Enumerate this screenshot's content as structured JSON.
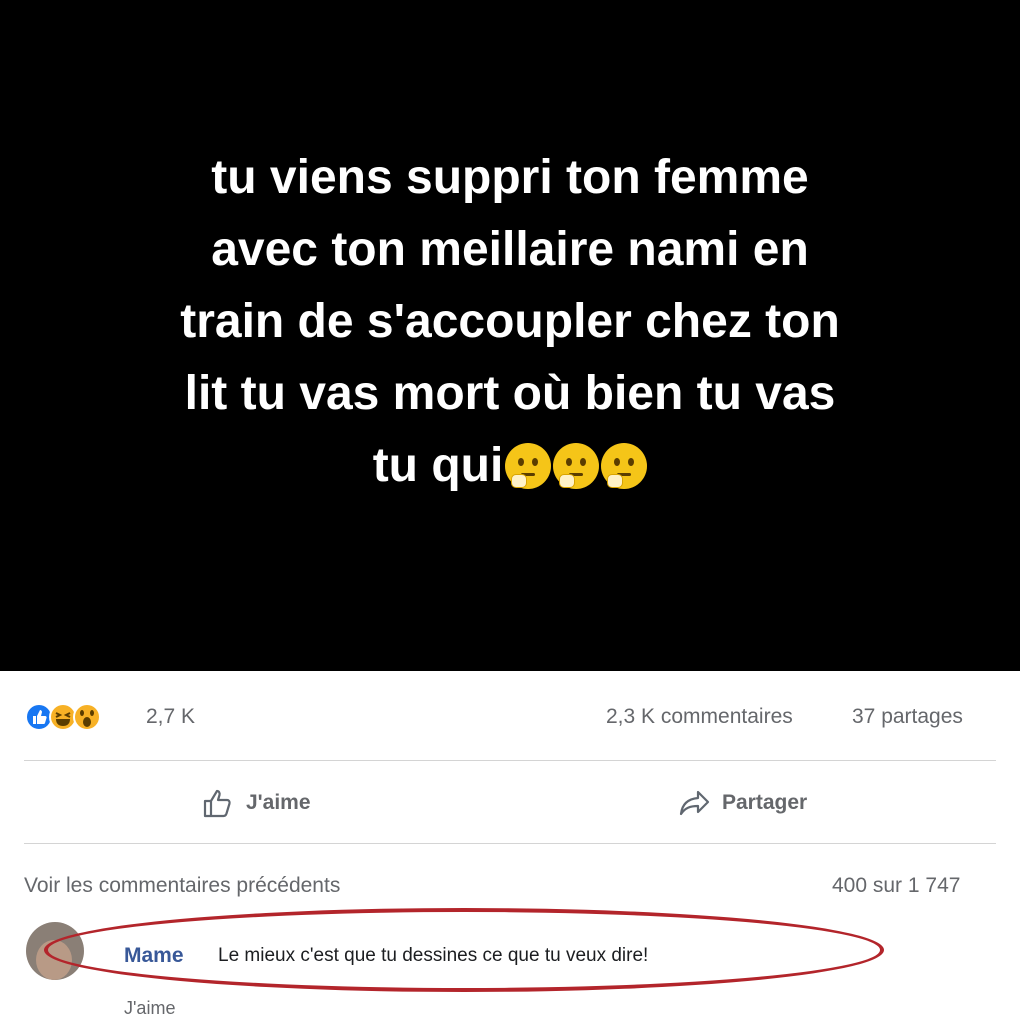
{
  "post": {
    "lines": [
      "tu viens suppri ton femme",
      "avec ton meillaire nami en",
      "train de s'accoupler chez ton",
      "lit tu vas mort où bien tu vas",
      "tu qui"
    ],
    "trailing_emojis": [
      "thinking-face-icon",
      "thinking-face-icon",
      "thinking-face-icon"
    ]
  },
  "stats": {
    "reactions_count": "2,7 K",
    "reaction_icons": [
      "like-reaction-icon",
      "haha-reaction-icon",
      "wow-reaction-icon"
    ],
    "comments": "2,3 K commentaires",
    "shares": "37 partages"
  },
  "actions": {
    "like_label": "J'aime",
    "share_label": "Partager"
  },
  "comments_section": {
    "previous_label": "Voir les commentaires précédents",
    "pagination": "400 sur 1 747",
    "comment": {
      "author": "Mame",
      "text": "Le mieux c'est que tu dessines ce que tu veux dire!",
      "like_label": "J'aime"
    },
    "highlight_color": "#b3252b"
  }
}
